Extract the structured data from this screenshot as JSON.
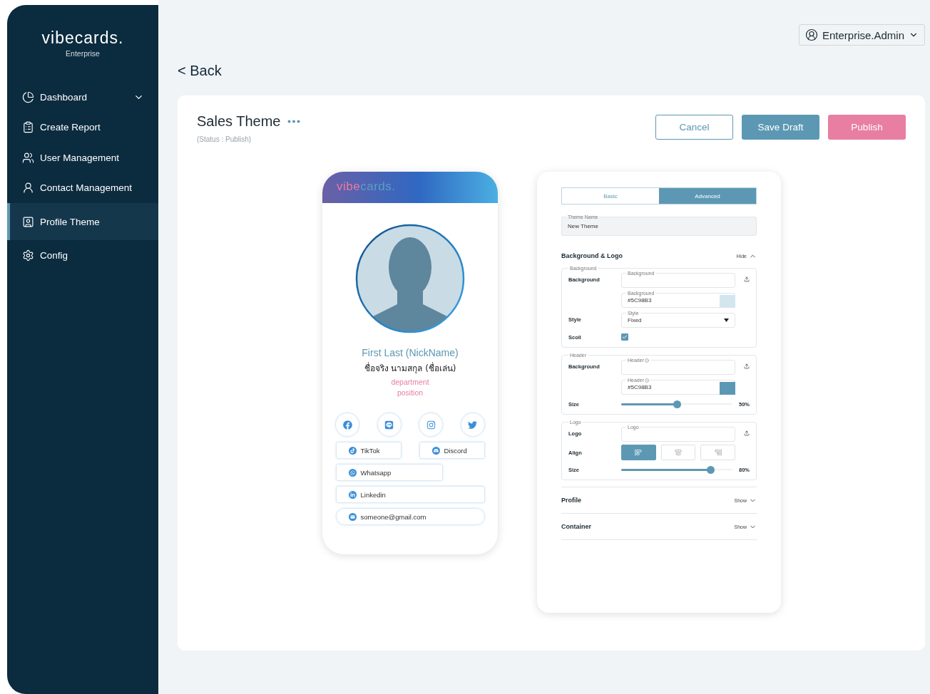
{
  "sidebar": {
    "logo": "vibecards.",
    "subtitle": "Enterprise",
    "items": [
      {
        "label": "Dashboard",
        "expandable": true,
        "selected": false
      },
      {
        "label": "Create Report",
        "expandable": false,
        "selected": false
      },
      {
        "label": "User Management",
        "expandable": false,
        "selected": false
      },
      {
        "label": "Contact Management",
        "expandable": false,
        "selected": false
      },
      {
        "label": "Profile Theme",
        "expandable": false,
        "selected": true
      },
      {
        "label": "Config",
        "expandable": false,
        "selected": false
      }
    ]
  },
  "user_menu": {
    "label": "Enterprise.Admin"
  },
  "back_link": "< Back",
  "page": {
    "title": "Sales Theme",
    "status": "(Status : Publish)",
    "buttons": [
      {
        "label": "Cancel",
        "kind": "outline"
      },
      {
        "label": "Save Draft",
        "kind": "secondary"
      },
      {
        "label": "Publish",
        "kind": "primary"
      }
    ]
  },
  "preview": {
    "logo_accent": "vibe",
    "logo_rest": "cards.",
    "name": "First Last (NickName)",
    "local_name": "ชื่อจริง นามสกุล (ชื่อเล่น)",
    "department": "department",
    "position": "position",
    "social_icons": [
      {
        "kind": "facebook"
      },
      {
        "kind": "line"
      },
      {
        "kind": "instagram"
      },
      {
        "kind": "twitter"
      }
    ],
    "links": [
      {
        "label": "TikTok",
        "kind": "tiktok"
      },
      {
        "label": "Discord",
        "kind": "discord"
      },
      {
        "label": "Whatsapp",
        "kind": "whatsapp"
      },
      {
        "label": "Linkedin",
        "kind": "linkedin"
      },
      {
        "label": "someone@gmail.com",
        "kind": "email"
      }
    ]
  },
  "settings": {
    "tabs": [
      {
        "label": "Basic",
        "selected": false
      },
      {
        "label": "Advanced",
        "selected": true
      }
    ],
    "theme_name": {
      "label": "Theme Name",
      "value": "New Theme"
    },
    "sections": [
      {
        "title": "Background & Logo",
        "toggle": "Hide",
        "expanded": true,
        "groups": [
          {
            "legend": "Background",
            "rows": [
              {
                "kind": "upload",
                "label": "Background",
                "field_label": "Background",
                "info": false
              },
              {
                "kind": "color",
                "field_label": "Background",
                "value": "#5C98B3",
                "color": "#d3e6ef",
                "info": false
              },
              {
                "kind": "select",
                "label": "Style",
                "field_label": "Style",
                "value": "Fixed"
              },
              {
                "kind": "checkbox",
                "label": "Scoll",
                "checked": true
              }
            ]
          },
          {
            "legend": "Header",
            "rows": [
              {
                "kind": "upload",
                "label": "Background",
                "field_label": "Header",
                "info": true
              },
              {
                "kind": "color",
                "field_label": "Header",
                "value": "#5C98B3",
                "color": "#5c98b3",
                "info": true
              },
              {
                "kind": "slider",
                "label": "Size",
                "level": 0.5,
                "reading": "50%"
              }
            ]
          },
          {
            "legend": "Logo",
            "rows": [
              {
                "kind": "upload",
                "label": "Logo",
                "field_label": "Logo",
                "info": false
              },
              {
                "kind": "align",
                "label": "Align",
                "options": [
                  {
                    "selected": true
                  },
                  {
                    "selected": false
                  },
                  {
                    "selected": false
                  }
                ]
              },
              {
                "kind": "slider",
                "label": "Size",
                "level": 0.8,
                "reading": "80%"
              }
            ]
          }
        ]
      },
      {
        "title": "Profile",
        "toggle": "Show",
        "expanded": false
      },
      {
        "title": "Container",
        "toggle": "Show",
        "expanded": false
      }
    ]
  }
}
